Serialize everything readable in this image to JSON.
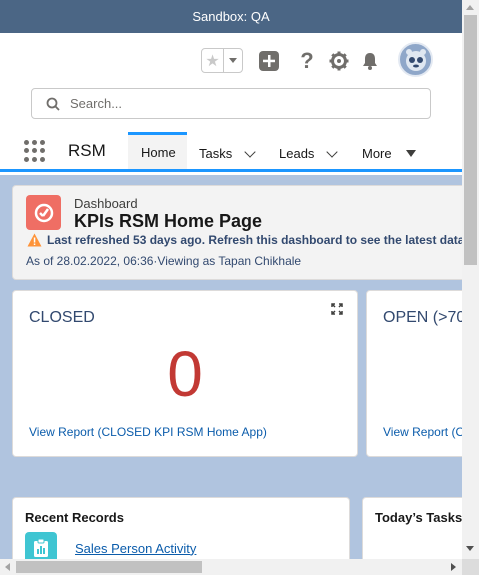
{
  "sandbox": {
    "label": "Sandbox: QA"
  },
  "search": {
    "placeholder": "Search..."
  },
  "nav": {
    "app_name": "RSM",
    "tabs": [
      {
        "label": "Home",
        "active": true
      },
      {
        "label": "Tasks"
      },
      {
        "label": "Leads"
      },
      {
        "label": "More"
      }
    ]
  },
  "dashboard": {
    "type_label": "Dashboard",
    "title": "KPIs RSM Home Page",
    "warning": "Last refreshed 53 days ago. Refresh this dashboard to see the latest data.",
    "as_of": "As of 28.02.2022, 06:36·Viewing as Tapan Chikhale"
  },
  "kpis": [
    {
      "title": "CLOSED",
      "value": "0",
      "link": "View Report (CLOSED KPI RSM Home App)"
    },
    {
      "title": "OPEN (>70",
      "link": "View Report (O"
    }
  ],
  "recent_records": {
    "title": "Recent Records",
    "items": [
      {
        "label": "Sales Person Activity"
      }
    ]
  },
  "todays_tasks": {
    "title": "Today’s Tasks"
  },
  "colors": {
    "brand": "#1b96ff",
    "kpi_value": "#c23934",
    "dashboard_icon": "#ef6e64",
    "record_icon": "#3fc5d2",
    "link": "#0b5cab"
  }
}
